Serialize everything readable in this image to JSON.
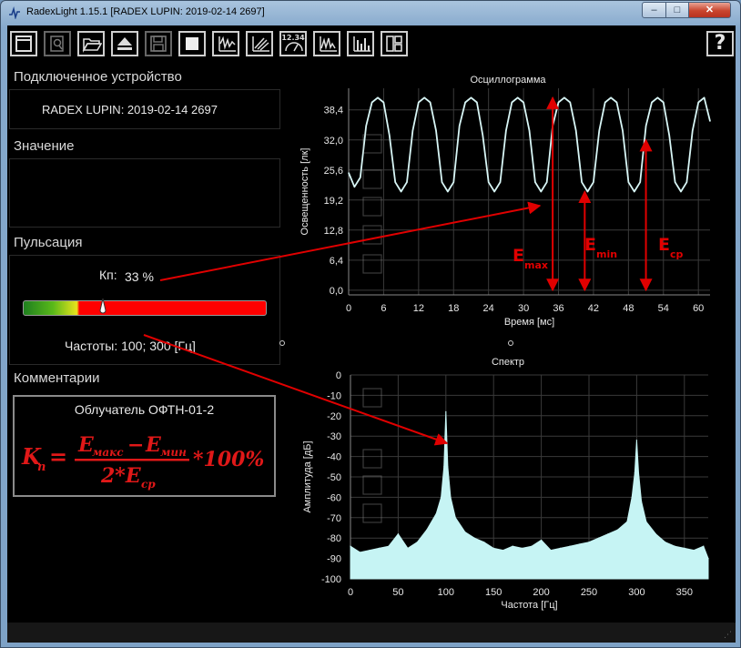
{
  "window": {
    "title": "RadexLight 1.15.1 [RADEX LUPIN: 2019-02-14 2697]",
    "minimize": "–",
    "maximize": "□",
    "close": "✕"
  },
  "toolbar": {
    "icons": [
      "window-icon",
      "search-icon",
      "open-folder-icon",
      "eject-icon",
      "save-icon",
      "stop-icon",
      "waveform-icon",
      "hatch-icon",
      "counter-icon",
      "spectrum-icon",
      "histogram-icon",
      "layout-icon",
      "help-icon"
    ],
    "counter_label": "12.34",
    "help_label": "?"
  },
  "left": {
    "device_heading": "Подключенное устройство",
    "device_name": "RADEX LUPIN: 2019-02-14 2697",
    "value_heading": "Значение",
    "pulse_heading": "Пульсация",
    "kp_label": "Кп:",
    "kp_value": "33 %",
    "kp_fraction": 0.33,
    "freq_text": "Частоты: 100; 300 [Гц]",
    "comments_heading": "Комментарии",
    "comment_title": "Облучатель ОФТН-01-2",
    "formula": {
      "lhs": "K",
      "lhs_sub": "п",
      "num_e1": "E",
      "num_e1_sub": "макс",
      "minus": "−",
      "num_e2": "E",
      "num_e2_sub": "мин",
      "times": "*100%",
      "den": "2*E",
      "den_sub": "ср"
    }
  },
  "colors": {
    "trace": "#d8f6f6",
    "spectrum_fill": "#c6f4f4",
    "annotation": "#e00000",
    "grid": "#3a3a3a"
  },
  "annotations": {
    "emax": "E",
    "emax_sub": "max",
    "emin": "E",
    "emin_sub": "min",
    "ecp": "E",
    "ecp_sub": "cp"
  },
  "chart_data": [
    {
      "type": "line",
      "title": "Осциллограмма",
      "xlabel": "Время [мс]",
      "ylabel": "Освещенность [лк]",
      "xlim": [
        0,
        62
      ],
      "ylim": [
        -1,
        43
      ],
      "xticks": [
        0,
        6,
        12,
        18,
        24,
        30,
        36,
        42,
        48,
        54,
        60
      ],
      "yticks": [
        "0,0",
        "6,4",
        "12,8",
        "19,2",
        "25,6",
        "32,0",
        "38,4"
      ],
      "ytick_values": [
        0,
        6.4,
        12.8,
        19.2,
        25.6,
        32.0,
        38.4
      ],
      "grid": true,
      "period_ms": 10,
      "max": 41.0,
      "min": 21.0,
      "x": [
        0,
        1,
        2,
        3,
        4,
        5,
        6,
        7,
        8,
        9,
        10,
        11,
        12,
        13,
        14,
        15,
        16,
        17,
        18,
        19,
        20,
        21,
        22,
        23,
        24,
        25,
        26,
        27,
        28,
        29,
        30,
        31,
        32,
        33,
        34,
        35,
        36,
        37,
        38,
        39,
        40,
        41,
        42,
        43,
        44,
        45,
        46,
        47,
        48,
        49,
        50,
        51,
        52,
        53,
        54,
        55,
        56,
        57,
        58,
        59,
        60,
        61,
        62
      ],
      "y": [
        25,
        22,
        24,
        35,
        40,
        41,
        40,
        33,
        23,
        21,
        23,
        34,
        40,
        41,
        40,
        34,
        23,
        21,
        23,
        35,
        40,
        41,
        40,
        33,
        23,
        21,
        23,
        34,
        40,
        41,
        40,
        34,
        23,
        21,
        23,
        35,
        40,
        41,
        40,
        34,
        23,
        21,
        23,
        34,
        40,
        41,
        40,
        34,
        23,
        21,
        23,
        35,
        40,
        41,
        40,
        33,
        23,
        21,
        23,
        34,
        40,
        41,
        36
      ]
    },
    {
      "type": "area",
      "title": "Спектр",
      "xlabel": "Частота [Гц]",
      "ylabel": "Амплитуда [дБ]",
      "xlim": [
        0,
        375
      ],
      "ylim": [
        -100,
        0
      ],
      "xticks": [
        0,
        50,
        100,
        150,
        200,
        250,
        300,
        350
      ],
      "yticks": [
        0,
        -10,
        -20,
        -30,
        -40,
        -50,
        -60,
        -70,
        -80,
        -90,
        -100
      ],
      "grid": true,
      "x": [
        0,
        10,
        20,
        30,
        40,
        50,
        60,
        70,
        80,
        90,
        95,
        98,
        100,
        102,
        105,
        110,
        120,
        130,
        140,
        150,
        160,
        170,
        180,
        190,
        200,
        210,
        220,
        230,
        240,
        250,
        260,
        270,
        280,
        290,
        295,
        298,
        300,
        302,
        305,
        310,
        320,
        330,
        340,
        350,
        360,
        370,
        375
      ],
      "values": [
        -84,
        -87,
        -86,
        -85,
        -84,
        -78,
        -85,
        -82,
        -76,
        -68,
        -60,
        -45,
        -18,
        -45,
        -60,
        -70,
        -77,
        -80,
        -82,
        -85,
        -86,
        -84,
        -85,
        -84,
        -81,
        -86,
        -85,
        -84,
        -83,
        -82,
        -80,
        -78,
        -76,
        -72,
        -60,
        -48,
        -32,
        -48,
        -62,
        -72,
        -78,
        -82,
        -84,
        -85,
        -86,
        -84,
        -90
      ]
    }
  ]
}
